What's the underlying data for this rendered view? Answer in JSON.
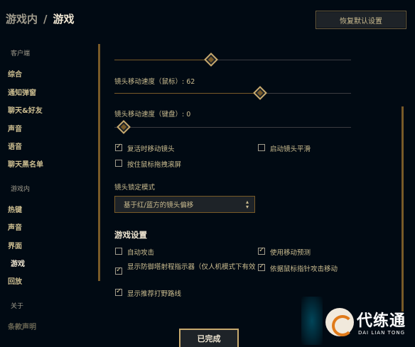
{
  "header": {
    "breadcrumb_parent": "游戏内",
    "breadcrumb_sep": "/",
    "breadcrumb_current": "游戏",
    "restore_label": "恢复默认设置"
  },
  "sidebar": {
    "client_header": "客户端",
    "client_items": [
      "综合",
      "通知弹窗",
      "聊天&好友",
      "声音",
      "语音",
      "聊天黑名单"
    ],
    "ingame_header": "游戏内",
    "ingame_items": [
      "热键",
      "声音",
      "界面",
      "游戏",
      "回放"
    ],
    "about_header": "关于",
    "about_items": [
      "条款声明"
    ],
    "active_item": "游戏"
  },
  "sliders": {
    "top": {
      "level": 0.4
    },
    "mouse": {
      "label": "镜头移动速度（鼠标）:",
      "value": "62",
      "level": 0.62
    },
    "keyboard": {
      "label": "镜头移动速度（键盘）:",
      "value": "0",
      "level": 0.0
    }
  },
  "camera_options": [
    {
      "label": "复活时移动镜头",
      "checked": true
    },
    {
      "label": "启动镜头平滑",
      "checked": false
    },
    {
      "label": "按住鼠标拖拽滚屏",
      "checked": false
    }
  ],
  "lock_mode": {
    "label": "镜头锁定模式",
    "selected": "基于红/蓝方的镜头偏移"
  },
  "game_settings": {
    "heading": "游戏设置",
    "options": [
      {
        "label": "自动攻击",
        "checked": false
      },
      {
        "label": "使用移动预测",
        "checked": true
      },
      {
        "label": "显示防御塔射程指示器（仅人机模式下有效",
        "checked": true
      },
      {
        "label": "依据鼠标指针攻击移动",
        "checked": true
      },
      {
        "label": "显示推荐打野路线",
        "checked": true
      }
    ]
  },
  "footer": {
    "done_label": "已完成"
  },
  "watermark": {
    "title": "代练通",
    "subtitle": "DAI LIAN TONG"
  },
  "colors": {
    "gold": "#c8aa6e",
    "gold_dark": "#785a28",
    "text": "#cdbe91",
    "bg": "#010a13"
  }
}
